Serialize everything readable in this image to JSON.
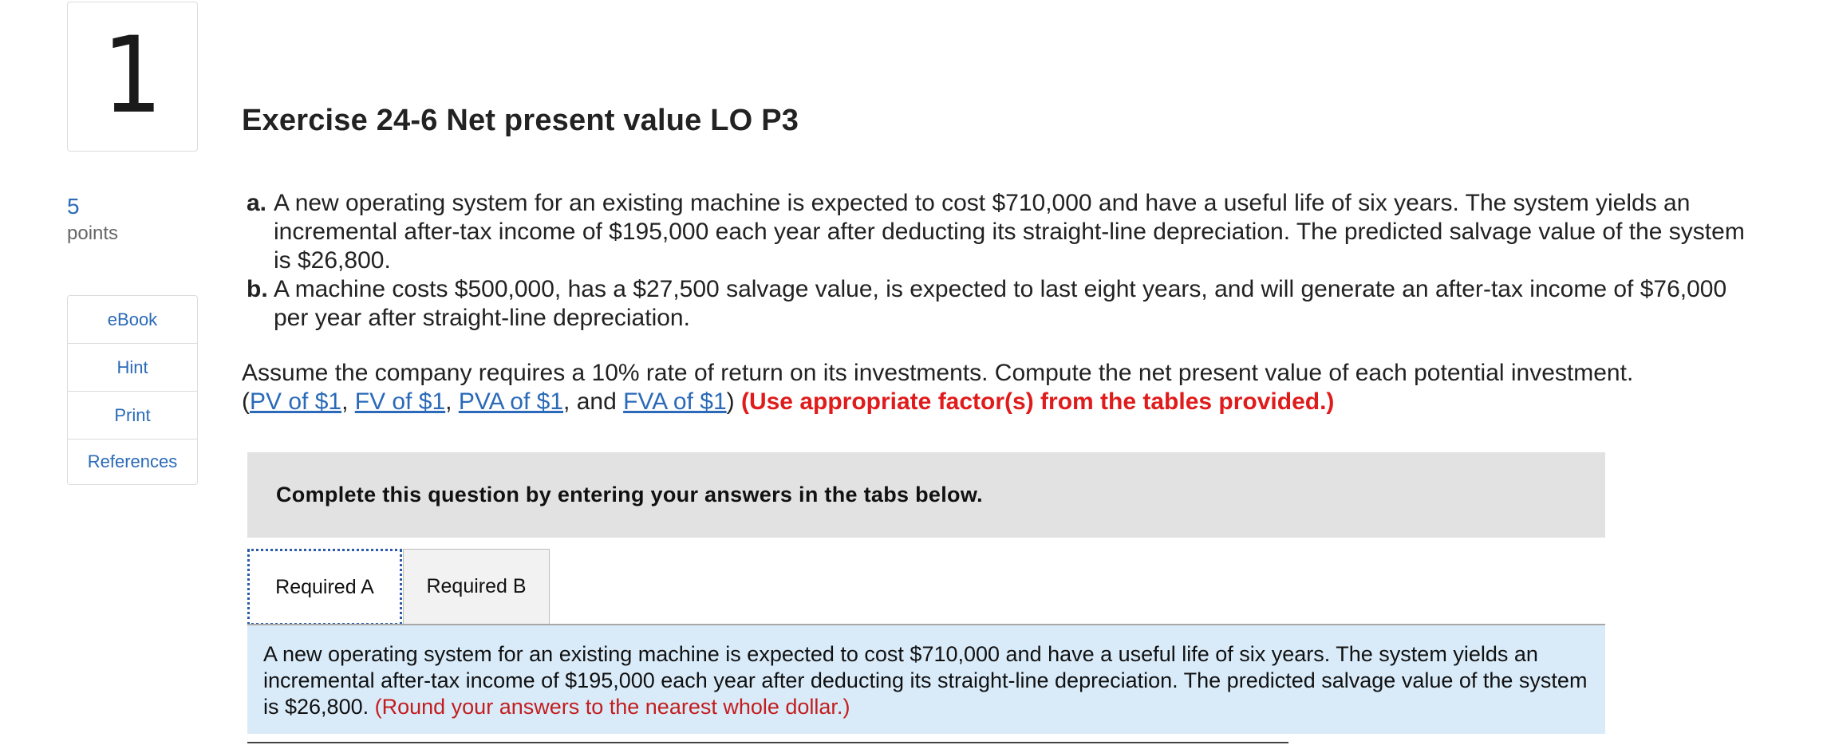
{
  "question": {
    "number": "1",
    "points_value": "5",
    "points_label": "points"
  },
  "sidebar": {
    "links": [
      {
        "label": "eBook"
      },
      {
        "label": "Hint"
      },
      {
        "label": "Print"
      },
      {
        "label": "References"
      }
    ]
  },
  "exercise": {
    "title": "Exercise 24-6 Net present value LO P3",
    "items": [
      {
        "letter": "a.",
        "text": "A new operating system for an existing machine is expected to cost $710,000 and have a useful life of six years. The system yields an incremental after-tax income of $195,000 each year after deducting its straight-line depreciation. The predicted salvage value of the system is $26,800."
      },
      {
        "letter": "b.",
        "text": "A machine costs $500,000, has a $27,500 salvage value, is expected to last eight years, and will generate an after-tax income of $76,000 per year after straight-line depreciation."
      }
    ],
    "assumption": "Assume the company requires a 10% rate of return on its investments. Compute the net present value of each potential investment.",
    "table_links": {
      "open_paren": "(",
      "pv": "PV of $1",
      "sep1": ", ",
      "fv": "FV of $1",
      "sep2": ", ",
      "pva": "PVA of $1",
      "sep3": ", and ",
      "fva": "FVA of $1",
      "close_paren": ") ",
      "emphasis": "(Use appropriate factor(s) from the tables provided.)"
    }
  },
  "instructions": "Complete this question by entering your answers in the tabs below.",
  "tabs": [
    {
      "label": "Required A",
      "active": true
    },
    {
      "label": "Required B",
      "active": false
    }
  ],
  "required_a": {
    "text": "A new operating system for an existing machine is expected to cost $710,000 and have a useful life of six years. The system yields an incremental after-tax income of $195,000 each year after deducting its straight-line depreciation. The predicted salvage value of the system is $26,800. ",
    "note": "(Round your answers to the nearest whole dollar.)"
  },
  "colors": {
    "link": "#2a6ab8",
    "emphasis": "#e01b1b",
    "panel_bg": "#d9ebf9",
    "instruct_bg": "#e2e2e2"
  }
}
